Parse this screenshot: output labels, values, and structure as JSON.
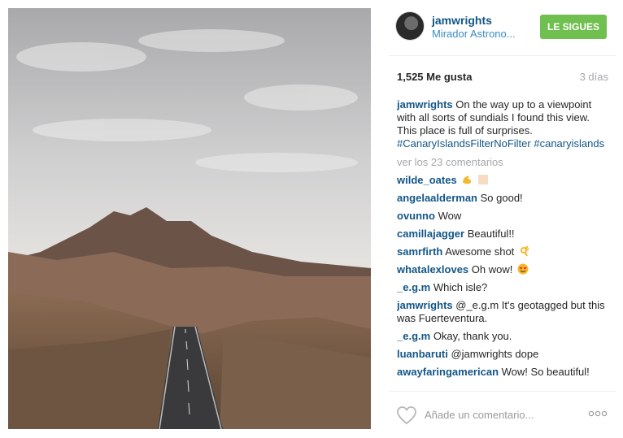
{
  "post": {
    "username": "jamwrights",
    "location": "Mirador Astrono...",
    "follow_label": "LE SIGUES",
    "likes": "1,525 Me gusta",
    "age": "3 días"
  },
  "caption": {
    "user": "jamwrights",
    "text": "On the way up to a viewpoint with all sorts of sundials I found this view. This place is full of surprises.",
    "hashtag1": "#CanaryIslandsFilterNoFilter",
    "hashtag2": "#canaryislands"
  },
  "view_more": "ver los 23 comentarios",
  "comments": [
    {
      "user": "wilde_oates",
      "text": ""
    },
    {
      "user": "angelaalderman",
      "text": "So good!"
    },
    {
      "user": "ovunno",
      "text": "Wow"
    },
    {
      "user": "camillajagger",
      "text": "Beautiful!!"
    },
    {
      "user": "samrfirth",
      "text": "Awesome shot"
    },
    {
      "user": "whatalexloves",
      "text": "Oh wow!"
    },
    {
      "user": "_e.g.m",
      "text": "Which isle?"
    },
    {
      "user": "jamwrights",
      "text": "@_e.g.m It's geotagged but this was Fuerteventura."
    },
    {
      "user": "_e.g.m",
      "text": "Okay, thank you."
    },
    {
      "user": "luanbaruti",
      "text": "@jamwrights dope"
    },
    {
      "user": "awayfaringamerican",
      "text": "Wow! So beautiful!"
    }
  ],
  "footer": {
    "comment_placeholder": "Añade un comentario..."
  },
  "icons": {
    "avatar": "avatar",
    "heart": "heart-outline-icon",
    "more": "more-options-icon",
    "emoji_flex": "flexed-biceps-emoji",
    "emoji_ok": "ok-hand-emoji",
    "emoji_eyes": "heart-eyes-emoji"
  },
  "colors": {
    "username": "#125688",
    "location": "#3b8bc5",
    "follow_button": "#70c050",
    "muted": "#a5a7aa"
  }
}
